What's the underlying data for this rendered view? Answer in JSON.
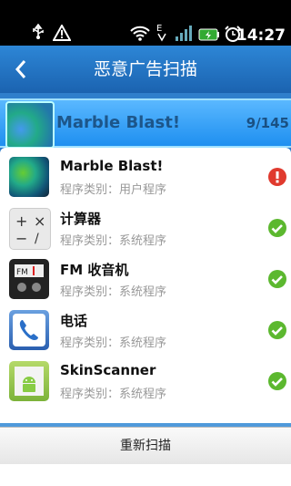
{
  "status_bar": {
    "time": "14:27",
    "icons": [
      "usb-icon",
      "warning-icon",
      "wifi-icon",
      "data-e-icon",
      "signal-icon",
      "battery-icon",
      "alarm-icon"
    ]
  },
  "header": {
    "title": "恶意广告扫描"
  },
  "scan": {
    "current_app": "Marble Blast!",
    "progress": "9/145"
  },
  "apps": [
    {
      "name": "Marble Blast!",
      "type": "程序类别：用户程序",
      "status": "warning",
      "icon": "marble-blast-icon"
    },
    {
      "name": "计算器",
      "type": "程序类别：系统程序",
      "status": "ok",
      "icon": "calculator-icon"
    },
    {
      "name": "FM 收音机",
      "type": "程序类别：系统程序",
      "status": "ok",
      "icon": "fm-radio-icon"
    },
    {
      "name": "电话",
      "type": "程序类别：系统程序",
      "status": "ok",
      "icon": "phone-icon"
    },
    {
      "name": "SkinScanner",
      "type": "程序类别：系统程序",
      "status": "ok",
      "icon": "android-app-icon"
    }
  ],
  "footer": {
    "rescan_label": "重新扫描"
  },
  "colors": {
    "accent": "#1f67b3",
    "ok": "#5cb82f",
    "warning": "#e03a2e"
  }
}
